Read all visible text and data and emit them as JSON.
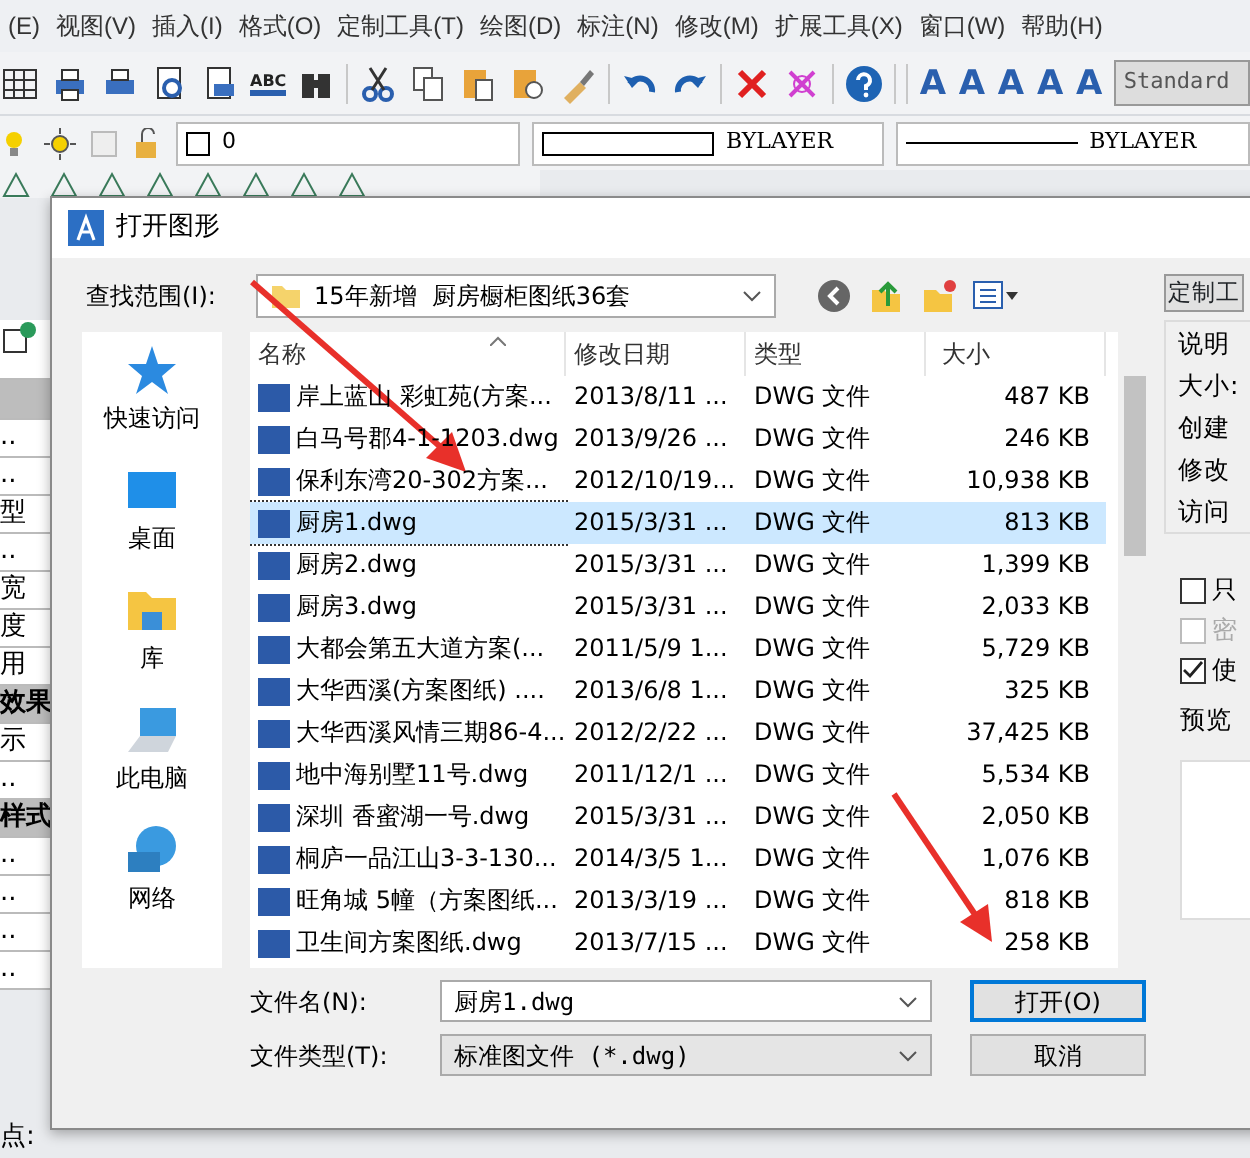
{
  "menu": [
    "(E)",
    "视图(V)",
    "插入(I)",
    "格式(O)",
    "定制工具(T)",
    "绘图(D)",
    "标注(N)",
    "修改(M)",
    "扩展工具(X)",
    "窗口(W)",
    "帮助(H)"
  ],
  "toolbar": {
    "spell_icon_text": "ABC",
    "text_style_icons": [
      "A",
      "A",
      "A",
      "A",
      "A"
    ],
    "text_style_field": "Standard"
  },
  "layer_bar": {
    "layer": "0",
    "color_setting": "BYLAYER",
    "linetype": "BYLAYER"
  },
  "side_panel": [
    {
      "text": "..",
      "kind": "row"
    },
    {
      "text": "..",
      "kind": "row"
    },
    {
      "text": "型",
      "kind": "row"
    },
    {
      "text": "..",
      "kind": "row"
    },
    {
      "text": "宽",
      "kind": "row"
    },
    {
      "text": "度",
      "kind": "row"
    },
    {
      "text": "用",
      "kind": "row"
    },
    {
      "text": "效果",
      "kind": "header"
    },
    {
      "text": "示",
      "kind": "row"
    },
    {
      "text": "..",
      "kind": "row"
    },
    {
      "text": "样式",
      "kind": "header"
    },
    {
      "text": "..",
      "kind": "row"
    },
    {
      "text": "..",
      "kind": "row"
    },
    {
      "text": "..",
      "kind": "row"
    },
    {
      "text": "..",
      "kind": "row"
    }
  ],
  "command_line": "点:",
  "dialog": {
    "title": "打开图形",
    "look_in_label": "查找范围(I):",
    "look_in": "15年新增  厨房橱柜图纸36套",
    "places": [
      "快速访问",
      "桌面",
      "库",
      "此电脑",
      "网络"
    ],
    "columns": [
      "名称",
      "修改日期",
      "类型",
      "大小"
    ],
    "rows": [
      {
        "name": "岸上蓝山 彩虹苑(方案...",
        "date": "2013/8/11 ...",
        "type": "DWG 文件",
        "size": "487 KB",
        "selected": false
      },
      {
        "name": "白马号郡4-1-1203.dwg",
        "date": "2013/9/26 ...",
        "type": "DWG 文件",
        "size": "246 KB",
        "selected": false
      },
      {
        "name": "保利东湾20-302方案...",
        "date": "2012/10/19...",
        "type": "DWG 文件",
        "size": "10,938 KB",
        "selected": false
      },
      {
        "name": "厨房1.dwg",
        "date": "2015/3/31 ...",
        "type": "DWG 文件",
        "size": "813 KB",
        "selected": true
      },
      {
        "name": "厨房2.dwg",
        "date": "2015/3/31 ...",
        "type": "DWG 文件",
        "size": "1,399 KB",
        "selected": false
      },
      {
        "name": "厨房3.dwg",
        "date": "2015/3/31 ...",
        "type": "DWG 文件",
        "size": "2,033 KB",
        "selected": false
      },
      {
        "name": "大都会第五大道方案(...",
        "date": "2011/5/9 1...",
        "type": "DWG 文件",
        "size": "5,729 KB",
        "selected": false
      },
      {
        "name": "大华西溪(方案图纸) ....",
        "date": "2013/6/8 1...",
        "type": "DWG 文件",
        "size": "325 KB",
        "selected": false
      },
      {
        "name": "大华西溪风情三期86-4...",
        "date": "2012/2/22 ...",
        "type": "DWG 文件",
        "size": "37,425 KB",
        "selected": false
      },
      {
        "name": "地中海别墅11号.dwg",
        "date": "2011/12/1 ...",
        "type": "DWG 文件",
        "size": "5,534 KB",
        "selected": false
      },
      {
        "name": "深圳 香蜜湖一号.dwg",
        "date": "2015/3/31 ...",
        "type": "DWG 文件",
        "size": "2,050 KB",
        "selected": false
      },
      {
        "name": "桐庐一品江山3-3-130...",
        "date": "2014/3/5 1...",
        "type": "DWG 文件",
        "size": "1,076 KB",
        "selected": false
      },
      {
        "name": "旺角城 5幢（方案图纸...",
        "date": "2013/3/19 ...",
        "type": "DWG 文件",
        "size": "818 KB",
        "selected": false
      },
      {
        "name": "卫生间方案图纸.dwg",
        "date": "2013/7/15 ...",
        "type": "DWG 文件",
        "size": "258 KB",
        "selected": false
      }
    ],
    "file_name_label": "文件名(N):",
    "file_name": "厨房1.dwg",
    "file_type_label": "文件类型(T):",
    "file_type": "标准图文件 (*.dwg)",
    "buttons": [
      "打开(O)",
      "取消"
    ],
    "side": {
      "custom_button": "定制工",
      "info": [
        "说明",
        "大小:",
        "创建",
        "修改",
        "访问"
      ],
      "options": [
        {
          "label": "只",
          "checked": false,
          "disabled": false
        },
        {
          "label": "密",
          "checked": false,
          "disabled": true
        },
        {
          "label": "使",
          "checked": true,
          "disabled": false
        }
      ],
      "preview_label": "预览"
    }
  }
}
